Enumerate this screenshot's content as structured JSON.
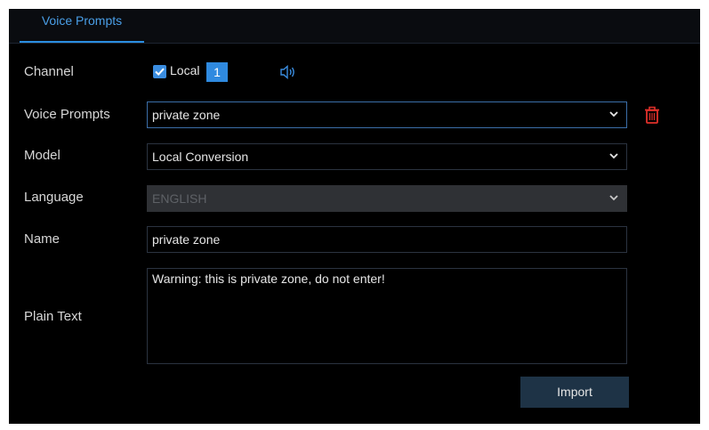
{
  "tab": {
    "label": "Voice Prompts"
  },
  "channel": {
    "label": "Channel",
    "checkbox_label": "Local",
    "checkbox_checked": true,
    "number": "1"
  },
  "voice_prompts": {
    "label": "Voice Prompts",
    "value": "private zone"
  },
  "model": {
    "label": "Model",
    "value": "Local Conversion"
  },
  "language": {
    "label": "Language",
    "value": "ENGLISH",
    "disabled": true
  },
  "name": {
    "label": "Name",
    "value": "private zone"
  },
  "plain_text": {
    "label": "Plain Text",
    "value": "Warning: this is private zone, do not enter!"
  },
  "import_button": {
    "label": "Import"
  },
  "icons": {
    "speaker": "speaker-icon",
    "trash": "trash-icon",
    "chevron": "chevron-down-icon",
    "check": "checkmark-icon"
  },
  "colors": {
    "accent": "#2f8ae0",
    "trash": "#e0302a",
    "button_bg": "#1e3346",
    "panel_bg": "#000000"
  }
}
